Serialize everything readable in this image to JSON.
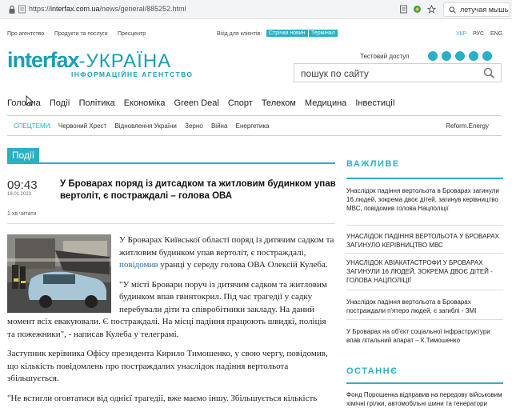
{
  "browser": {
    "url_prefix": "https://",
    "url_host": "interfax.com.ua",
    "url_path": "/news/general/885252.html",
    "search_text": "летучая мышь"
  },
  "topbar": {
    "about": "Про агентство",
    "products": "Продукти та послуги",
    "press": "Пресцентр",
    "login_label": "Вхід для клієнтів:",
    "btn_stream": "Стрічки новин",
    "btn_terminal": "Термінал",
    "lang_ukr": "УКР",
    "lang_rus": "РУС",
    "lang_eng": "ENG"
  },
  "logo": {
    "brand": "interfax",
    "brand_suffix": "-УКРАЇНА",
    "tagline": "ІНФОРМАЦІЙНЕ АГЕНТСТВО"
  },
  "header": {
    "test_access": "Тестовий доступ",
    "search_placeholder": "пошук по сайту"
  },
  "nav": [
    "Головна",
    "Події",
    "Політика",
    "Економіка",
    "Green Deal",
    "Спорт",
    "Телеком",
    "Медицина",
    "Інвестиції"
  ],
  "special": {
    "label": "СПЕЦТЕМИ:",
    "items": [
      "Червоний Хрест",
      "Відновлення України",
      "Зерно",
      "Війна",
      "Енергетика"
    ],
    "right": "Reform.Energy"
  },
  "article": {
    "category": "Події",
    "time": "09:43",
    "date": "18.01.2023",
    "title": "У Броварах поряд із дитсадком та житловим будинком упав вертоліт, є постраждалі – голова ОВА",
    "read_time": "1 хв читати",
    "p1_a": "У Броварах Київської області поряд із дитячим садком та житловим будинком упав вертоліт, є постраждалі, ",
    "p1_link": "повідомив",
    "p1_b": " уранці у середу голова ОВА Олексій Кулеба.",
    "p2": "\"У місті Бровари поруч із дитячим садком та житловим будинком впав гвинтокрил. Під час трагедії у садку перебували діти та співробітники закладу. На даний момент всіх евакуювали. Є постраждалі. На місці падіння працюють швидкі, поліція та пожежники\", - написав Кулеба у телеграмі.",
    "p3": "Заступник керівника Офісу президента Кирило Тимошенко, у свою чергу, повідомив, що кількість повідомлень про постраждалих унаслідок падіння вертольота збільшується.",
    "p4": "\"Не встигли оговтатися від однієї трагедії, вже маємо іншу. Збільшується кількість"
  },
  "sidebar": {
    "important_title": "ВАЖЛИВЕ",
    "important": [
      "Унаслідок падіння вертольота в Броварах загинули 16 людей, зокрема двоє дітей, загинув керівництво МВС, повідомив голова Нацполіції",
      "УНАСЛІДОК ПАДІННЯ ВЕРТОЛЬОТА У БРОВАРАХ ЗАГИНУЛО КЕРІВНИЦТВО МВС",
      "УНАСЛІДОК АВІАКАТАСТРОФИ У БРОВАРАХ ЗАГИНУЛИ 16 ЛЮДЕЙ, ЗОКРЕМА ДВОЄ ДІТЕЙ - ГОЛОВА НАЦПОЛІЦІЇ",
      "Унаслідок падіння вертольота в Броварах постраждали п'ятеро людей, є загиблі - ЗМІ",
      "У Броварах на об'єкт соціальної інфраструктури впав літальний апарат – К.Тимошенко"
    ],
    "latest_title": "ОСТАННЄ",
    "latest": [
      "Фонд Порошенка відправив на передову військовим хімічні грілки, автомобільні шини та генератори"
    ]
  },
  "colors": {
    "accent": "#2ab0c5",
    "link": "#2a6db0"
  }
}
